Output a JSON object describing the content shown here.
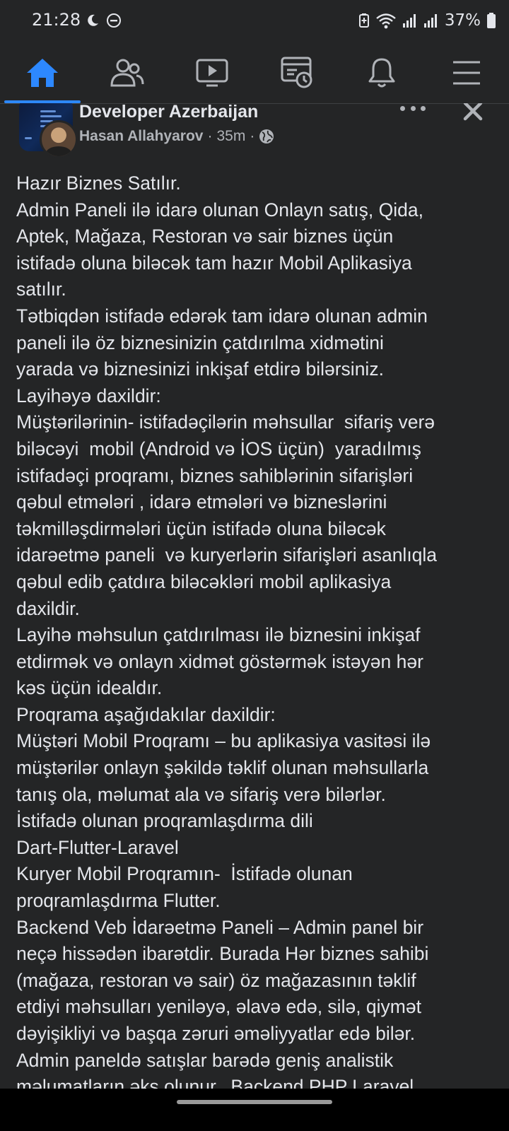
{
  "status_bar": {
    "time": "21:28",
    "battery": "37%"
  },
  "nav": {
    "tabs": [
      {
        "name": "home",
        "icon": "home-icon",
        "active": true
      },
      {
        "name": "friends",
        "icon": "friends-icon",
        "active": false
      },
      {
        "name": "watch",
        "icon": "video-icon",
        "active": false
      },
      {
        "name": "memories",
        "icon": "memories-icon",
        "active": false
      },
      {
        "name": "notifications",
        "icon": "bell-icon",
        "active": false
      },
      {
        "name": "menu",
        "icon": "menu-icon",
        "active": false
      }
    ],
    "accent_color": "#2d88ff"
  },
  "post": {
    "group_name": "Developer Azerbaijan",
    "author": "Hasan Allahyarov",
    "time_ago": "35m",
    "separator": "·",
    "audience_icon": "globe-icon",
    "lines": [
      "Hazır Biznes Satılır.",
      "Admin Paneli ilə idarə olunan Onlayn satış, Qida,",
      "Aptek, Mağaza, Restoran və sair biznes üçün",
      "istifadə oluna biləcək tam hazır Mobil Aplikasiya",
      "satılır.",
      "Tətbiqdən istifadə edərək tam idarə olunan admin",
      "paneli ilə öz biznesinizin çatdırılma xidmətini",
      "yarada və biznesinizi inkişaf etdirə bilərsiniz.",
      "Layihəyə daxildir:",
      "Müştərilərinin- istifadəçilərin məhsullar  sifariş verə",
      "biləcəyi  mobil (Android və İOS üçün)  yaradılmış",
      "istifadəçi proqramı, biznes sahiblərinin sifarişləri",
      "qəbul etmələri , idarə etmələri və bizneslərini",
      "təkmilləşdirmələri üçün istifadə oluna biləcək",
      "idarəetmə paneli  və kuryerlərin sifarişləri asanlıqla",
      "qəbul edib çatdıra biləcəkləri mobil aplikasiya",
      "daxildir.",
      "Layihə məhsulun çatdırılması ilə biznesini inkişaf",
      "etdirmək və onlayn xidmət göstərmək istəyən hər",
      "kəs üçün idealdır.",
      "Proqrama aşağıdakılar daxildir:",
      "Müştəri Mobil Proqramı – bu aplikasiya vasitəsi ilə",
      "müştərilər onlayn şəkildə təklif olunan məhsullarla",
      "tanış ola, məlumat ala və sifariş verə bilərlər.",
      "İstifadə olunan proqramlaşdırma dili",
      "Dart-Flutter-Laravel",
      "Kuryer Mobil Proqramın-  İstifadə olunan",
      "proqramlaşdırma Flutter.",
      "Backend Veb İdarəetmə Paneli – Admin panel bir",
      "neçə hissədən ibarətdir. Burada Hər biznes sahibi",
      "(mağaza, restoran və sair) öz mağazasının təklif",
      "etdiyi məhsulları yeniləyə, əlavə edə, silə, qiymət",
      "dəyişikliyi və başqa zəruri əməliyyatlar edə bilər.",
      "Admin paneldə satışlar barədə geniş analistik",
      "məlumatların əks olunur.  Backend PHP Laravel"
    ]
  }
}
